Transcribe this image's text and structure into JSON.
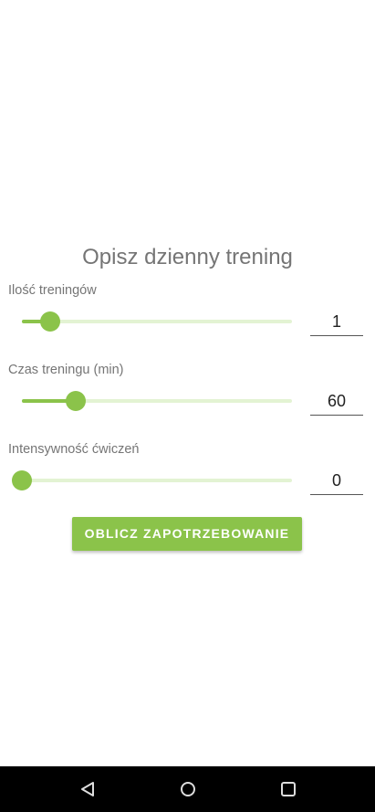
{
  "title": "Opisz dzienny trening",
  "sliders": [
    {
      "label": "Ilość treningów",
      "value": "1",
      "fraction": 0.105
    },
    {
      "label": "Czas treningu (min)",
      "value": "60",
      "fraction": 0.2
    },
    {
      "label": "Intensywność ćwiczeń",
      "value": "0",
      "fraction": 0
    }
  ],
  "button_label": "OBLICZ ZAPOTRZEBOWANIE",
  "colors": {
    "accent": "#8bc34a",
    "track": "#e3f3d3"
  }
}
